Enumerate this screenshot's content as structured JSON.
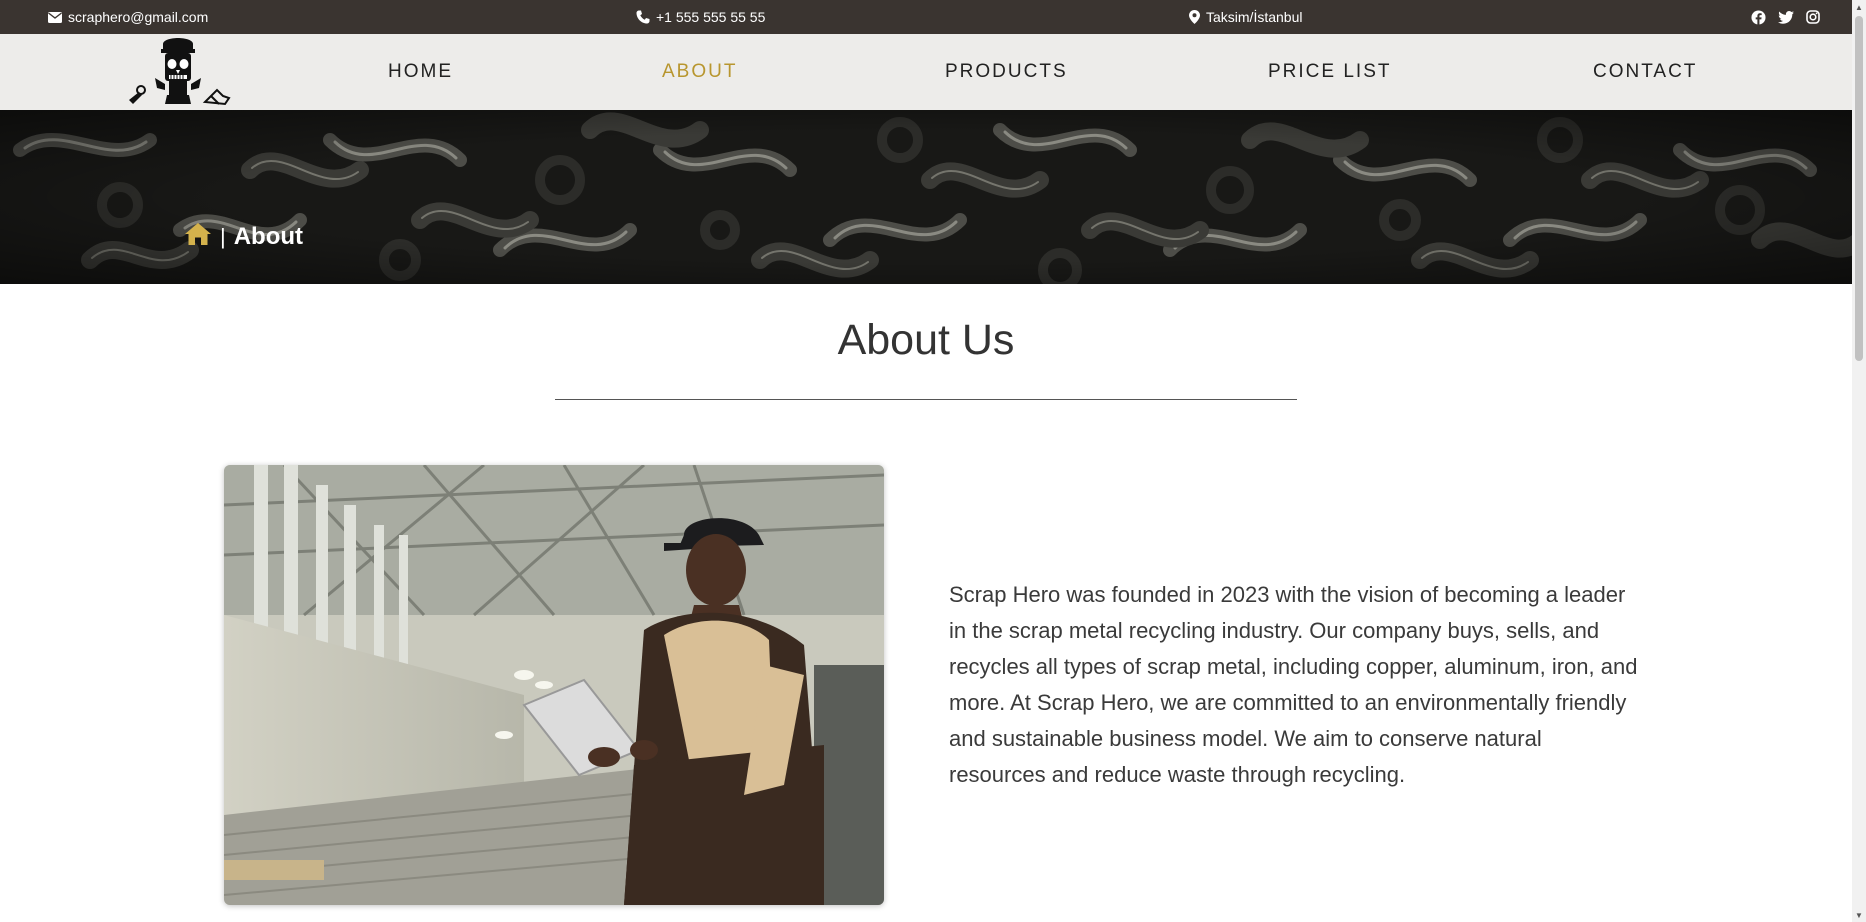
{
  "topbar": {
    "email": "scraphero@gmail.com",
    "phone": "+1 555 555 55 55",
    "location": "Taksim/İstanbul",
    "icons": {
      "email": "envelope-icon",
      "phone": "phone-icon",
      "location": "map-pin-icon"
    },
    "social": [
      "facebook-icon",
      "twitter-icon",
      "instagram-icon"
    ]
  },
  "nav": {
    "items": [
      "HOME",
      "ABOUT",
      "PRODUCTS",
      "PRICE LIST",
      "CONTACT"
    ],
    "active": "ABOUT",
    "active_color": "#b8962f"
  },
  "breadcrumb": {
    "separator": "|",
    "current": "About",
    "home_icon_color": "#d4b24c"
  },
  "about": {
    "title": "About Us",
    "text": "Scrap Hero was founded in 2023 with the vision of becoming a leader in the scrap metal recycling industry. Our company buys, sells, and recycles all types of scrap metal, including copper, aluminum, iron, and more. At Scrap Hero, we are committed to an environmentally friendly and sustainable business model. We aim to conserve natural resources and reduce waste through recycling."
  },
  "colors": {
    "topbar": "#3a3430",
    "navbar": "#edecea",
    "accent": "#b8962f"
  }
}
